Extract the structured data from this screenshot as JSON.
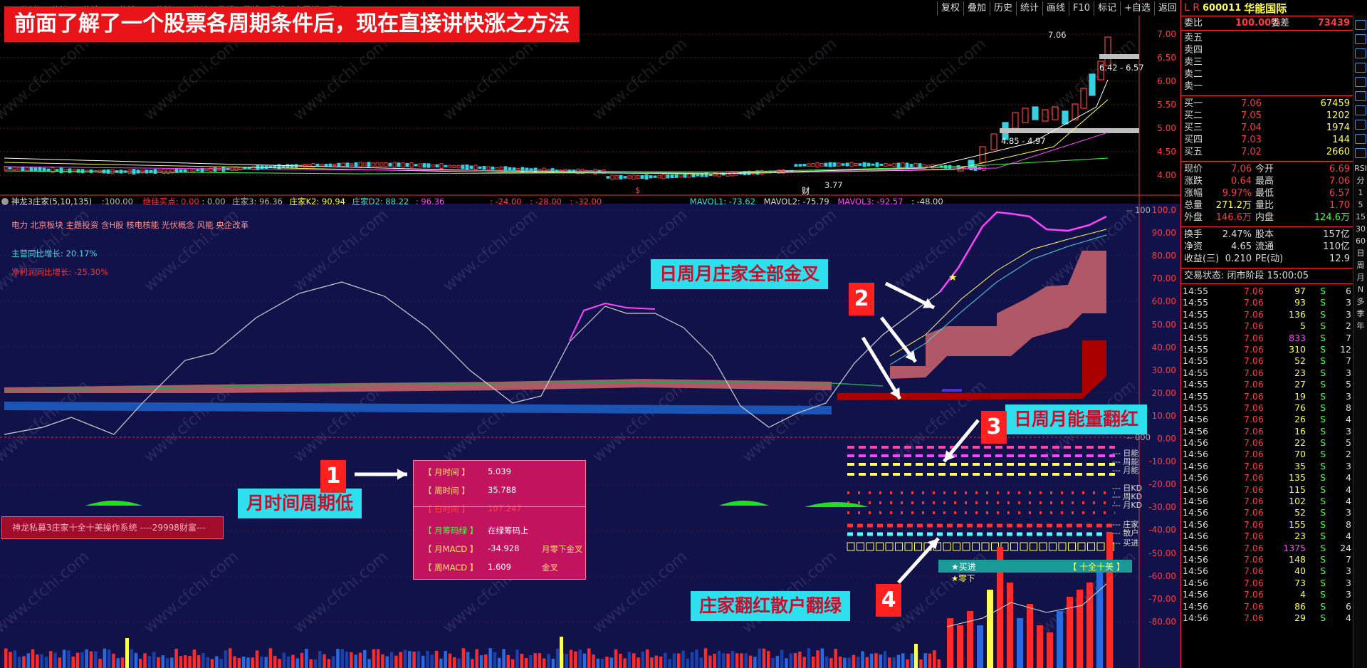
{
  "headline": "前面了解了一个股票各周期条件后，现在直接讲快涨之方法",
  "period_tabs": [
    "分时",
    "1分钟",
    "5分钟",
    "15分钟",
    "30分钟",
    "60分钟",
    "日线",
    "周线",
    "月线",
    "多周期",
    "更多"
  ],
  "toolbar": [
    "复权",
    "叠加",
    "历史",
    "统计",
    "画线",
    "F10",
    "标记",
    "+自选",
    "返回"
  ],
  "price_axis": [
    "7.00",
    "6.50",
    "6.00",
    "5.50",
    "5.00",
    "4.50",
    "4.00"
  ],
  "price_annotations": {
    "high": "7.06",
    "range_top": "6.42 - 6.57",
    "range_low": "4.85 - 4.97",
    "low": "3.77"
  },
  "indicator_header": {
    "name": "神龙3庄家(5,10,135)",
    "v1": ":100.00",
    "buy_point": "绝佳买点: 0.00",
    "zero": ": 0.00",
    "dealer3": "庄家3: 96.36",
    "k2": "庄家K2: 90.94",
    "d2": "庄家D2: 88.22",
    "d2v": ": 96.36",
    "n1": ": -24.00",
    "n2": ": -28.00",
    "n3": ": -32.00",
    "mavol1": "MAVOL1: -73.62",
    "mavol2": "MAVOL2: -75.79",
    "mavol3": "MAVOL3: -92.57",
    "n4": ": -48.00"
  },
  "concepts": "电力 北京板块 主题投资 含H股 核电核能 光伏概念 风能 央企改革",
  "growth": {
    "main": "主营同比增长: 20.17%",
    "net": "净利润同比增长: -25.30%"
  },
  "indicator_axis": [
    "100.0",
    "90.00",
    "80.00",
    "70.00",
    "60.00",
    "50.00",
    "40.00",
    "30.00",
    "20.00",
    "10.00",
    "0.00",
    "-10.00",
    "-20.00",
    "-30.00",
    "-40.00",
    "-50.00",
    "-60.00",
    "-70.00",
    "-80.00"
  ],
  "right_labels": [
    "日能",
    "周能",
    "月能",
    "日KD",
    "周KD",
    "月KD",
    "庄家",
    "散户",
    "买进"
  ],
  "axis_tag_100": "100",
  "axis_tag_000": "000",
  "annotations": {
    "month_low": "月时间周期低",
    "all_gold": "日周月庄家全部金叉",
    "energy_red": "日周月能量翻红",
    "dealer_red": "庄家翻红散户翻绿",
    "badge1": "1",
    "badge2": "2",
    "badge3": "3",
    "badge4": "4"
  },
  "popup": [
    {
      "label": "【 月时间 】",
      "value": "5.039",
      "note": ""
    },
    {
      "label": "【 周时间 】",
      "value": "35.788",
      "note": ""
    },
    {
      "label": "【 日时间 】",
      "value": "107.247",
      "note": ""
    },
    {
      "label": "【 月筹码绿 】",
      "value": "在绿筹码上",
      "note": ""
    },
    {
      "label": "【 月MACD 】",
      "value": "-34.928",
      "note": "月零下金叉"
    },
    {
      "label": "【 周MACD 】",
      "value": "1.609",
      "note": "金叉"
    }
  ],
  "system_banner": "神龙私募3庄家十全十美操作系统 ----29998财富---",
  "buy_bar": {
    "left": "★买进",
    "right": "【 十全十美 】",
    "below": "★零下"
  },
  "markers": {
    "s": "$",
    "cai": "财"
  },
  "quote": {
    "lr": "L R",
    "code": "600011",
    "name": "华能国际",
    "weibi_label": "委比",
    "weibi": "100.00%",
    "weicha_label": "委差",
    "weicha": "73439",
    "sells": [
      "卖五",
      "卖四",
      "卖三",
      "卖二",
      "卖一"
    ],
    "buys": [
      {
        "label": "买一",
        "price": "7.06",
        "vol": "67459"
      },
      {
        "label": "买二",
        "price": "7.05",
        "vol": "1202"
      },
      {
        "label": "买三",
        "price": "7.04",
        "vol": "1974"
      },
      {
        "label": "买四",
        "price": "7.03",
        "vol": "144"
      },
      {
        "label": "买五",
        "price": "7.02",
        "vol": "2660"
      }
    ],
    "stats": [
      {
        "l1": "现价",
        "v1": "7.06",
        "l2": "今开",
        "v2": "6.69"
      },
      {
        "l1": "涨跌",
        "v1": "0.64",
        "l2": "最高",
        "v2": "7.06"
      },
      {
        "l1": "涨幅",
        "v1": "9.97%",
        "l2": "最低",
        "v2": "6.57"
      },
      {
        "l1": "总量",
        "v1": "271.2万",
        "l2": "量比",
        "v2": "1.70"
      },
      {
        "l1": "外盘",
        "v1": "146.6万",
        "l2": "内盘",
        "v2": "124.6万"
      }
    ],
    "stats2": [
      {
        "l1": "换手",
        "v1": "2.47%",
        "l2": "股本",
        "v2": "157亿"
      },
      {
        "l1": "净资",
        "v1": "4.65",
        "l2": "流通",
        "v2": "110亿"
      },
      {
        "l1": "收益(三)",
        "v1": "0.210",
        "l2": "PE(动)",
        "v2": "12.9"
      }
    ],
    "trade_status": "交易状态: 闭市阶段 15:00:05",
    "trades": [
      [
        "14:55",
        "7.06",
        "97",
        "S",
        "6"
      ],
      [
        "14:55",
        "7.06",
        "93",
        "S",
        "3"
      ],
      [
        "14:55",
        "7.06",
        "136",
        "S",
        "3"
      ],
      [
        "14:55",
        "7.06",
        "5",
        "S",
        "2"
      ],
      [
        "14:55",
        "7.06",
        "833",
        "S",
        "7"
      ],
      [
        "14:55",
        "7.06",
        "310",
        "S",
        "12"
      ],
      [
        "14:55",
        "7.06",
        "52",
        "S",
        "7"
      ],
      [
        "14:55",
        "7.06",
        "23",
        "S",
        "3"
      ],
      [
        "14:55",
        "7.06",
        "27",
        "S",
        "5"
      ],
      [
        "14:55",
        "7.06",
        "19",
        "S",
        "3"
      ],
      [
        "14:55",
        "7.06",
        "76",
        "S",
        "8"
      ],
      [
        "14:56",
        "7.06",
        "26",
        "S",
        "4"
      ],
      [
        "14:56",
        "7.06",
        "16",
        "S",
        "3"
      ],
      [
        "14:56",
        "7.06",
        "22",
        "S",
        "5"
      ],
      [
        "14:56",
        "7.06",
        "70",
        "S",
        "2"
      ],
      [
        "14:56",
        "7.06",
        "35",
        "S",
        "3"
      ],
      [
        "14:56",
        "7.06",
        "135",
        "S",
        "4"
      ],
      [
        "14:56",
        "7.06",
        "115",
        "S",
        "4"
      ],
      [
        "14:56",
        "7.06",
        "102",
        "S",
        "4"
      ],
      [
        "14:56",
        "7.06",
        "52",
        "S",
        "3"
      ],
      [
        "14:56",
        "7.06",
        "155",
        "S",
        "8"
      ],
      [
        "14:56",
        "7.06",
        "23",
        "S",
        "4"
      ],
      [
        "14:56",
        "7.06",
        "1375",
        "S",
        "24"
      ],
      [
        "14:56",
        "7.06",
        "148",
        "S",
        "7"
      ],
      [
        "14:56",
        "7.06",
        "40",
        "S",
        "3"
      ],
      [
        "14:56",
        "7.06",
        "73",
        "S",
        "3"
      ],
      [
        "14:56",
        "7.06",
        "4",
        "S",
        "3"
      ],
      [
        "14:56",
        "7.06",
        "86",
        "S",
        "6"
      ],
      [
        "14:56",
        "7.06",
        "29",
        "S",
        "4"
      ]
    ]
  },
  "side_labels": [
    "RSI",
    "分",
    "1",
    "5",
    "15",
    "30",
    "60",
    "日",
    "周",
    "月",
    "N",
    "多",
    "季",
    "年"
  ],
  "colors": {
    "up": "#ff3b3b",
    "down": "#36d0e0",
    "yellow": "#ffff55",
    "magenta": "#ff44ff",
    "indicator_bg": "#11124a"
  },
  "watermark": "www.cfchi.com"
}
